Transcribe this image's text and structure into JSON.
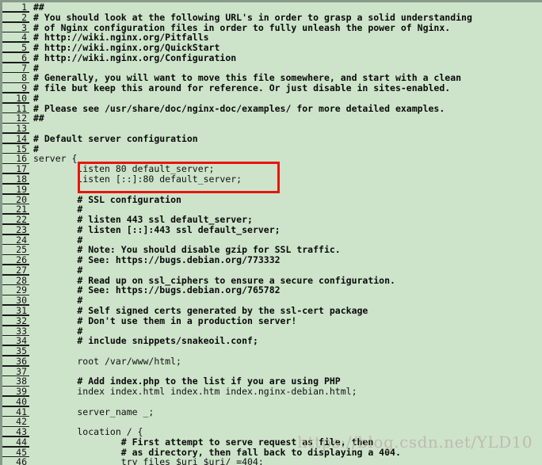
{
  "editor": {
    "background_color": "#cde4ca",
    "text_color": "#0b0b0b",
    "gutter_rule_color": "#1a1a1a",
    "border_color": "#8a9a8a",
    "file_kind": "nginx default site configuration"
  },
  "annotation": {
    "highlight_color": "#e8150f",
    "label": "listen directives highlighted"
  },
  "watermark": {
    "text": "https://blog.csdn.net/YLD10",
    "color": "#b8aaa2"
  },
  "lines": [
    {
      "n": "1",
      "text": "##",
      "style": "comment"
    },
    {
      "n": "2",
      "text": "# You should look at the following URL's in order to grasp a solid understanding",
      "style": "comment"
    },
    {
      "n": "3",
      "text": "# of Nginx configuration files in order to fully unleash the power of Nginx.",
      "style": "comment"
    },
    {
      "n": "4",
      "text": "# http://wiki.nginx.org/Pitfalls",
      "style": "comment"
    },
    {
      "n": "5",
      "text": "# http://wiki.nginx.org/QuickStart",
      "style": "comment"
    },
    {
      "n": "6",
      "text": "# http://wiki.nginx.org/Configuration",
      "style": "comment"
    },
    {
      "n": "7",
      "text": "#",
      "style": "comment"
    },
    {
      "n": "8",
      "text": "# Generally, you will want to move this file somewhere, and start with a clean",
      "style": "comment"
    },
    {
      "n": "9",
      "text": "# file but keep this around for reference. Or just disable in sites-enabled.",
      "style": "comment"
    },
    {
      "n": "10",
      "text": "#",
      "style": "comment"
    },
    {
      "n": "11",
      "text": "# Please see /usr/share/doc/nginx-doc/examples/ for more detailed examples.",
      "style": "comment"
    },
    {
      "n": "12",
      "text": "##",
      "style": "comment"
    },
    {
      "n": "13",
      "text": "",
      "style": "code"
    },
    {
      "n": "14",
      "text": "# Default server configuration",
      "style": "comment"
    },
    {
      "n": "15",
      "text": "#",
      "style": "comment"
    },
    {
      "n": "16",
      "text": "server {",
      "style": "code"
    },
    {
      "n": "17",
      "text": "        listen 80 default_server;",
      "style": "code"
    },
    {
      "n": "18",
      "text": "        listen [::]:80 default_server;",
      "style": "code"
    },
    {
      "n": "19",
      "text": "",
      "style": "code"
    },
    {
      "n": "20",
      "text": "        # SSL configuration",
      "style": "comment"
    },
    {
      "n": "21",
      "text": "        #",
      "style": "comment"
    },
    {
      "n": "22",
      "text": "        # listen 443 ssl default_server;",
      "style": "comment"
    },
    {
      "n": "23",
      "text": "        # listen [::]:443 ssl default_server;",
      "style": "comment"
    },
    {
      "n": "24",
      "text": "        #",
      "style": "comment"
    },
    {
      "n": "25",
      "text": "        # Note: You should disable gzip for SSL traffic.",
      "style": "comment"
    },
    {
      "n": "26",
      "text": "        # See: https://bugs.debian.org/773332",
      "style": "comment"
    },
    {
      "n": "27",
      "text": "        #",
      "style": "comment"
    },
    {
      "n": "28",
      "text": "        # Read up on ssl_ciphers to ensure a secure configuration.",
      "style": "comment"
    },
    {
      "n": "29",
      "text": "        # See: https://bugs.debian.org/765782",
      "style": "comment"
    },
    {
      "n": "30",
      "text": "        #",
      "style": "comment"
    },
    {
      "n": "31",
      "text": "        # Self signed certs generated by the ssl-cert package",
      "style": "comment"
    },
    {
      "n": "32",
      "text": "        # Don't use them in a production server!",
      "style": "comment"
    },
    {
      "n": "33",
      "text": "        #",
      "style": "comment"
    },
    {
      "n": "34",
      "text": "        # include snippets/snakeoil.conf;",
      "style": "comment"
    },
    {
      "n": "35",
      "text": "",
      "style": "code"
    },
    {
      "n": "36",
      "text": "        root /var/www/html;",
      "style": "code"
    },
    {
      "n": "37",
      "text": "",
      "style": "code"
    },
    {
      "n": "38",
      "text": "        # Add index.php to the list if you are using PHP",
      "style": "comment"
    },
    {
      "n": "39",
      "text": "        index index.html index.htm index.nginx-debian.html;",
      "style": "code"
    },
    {
      "n": "40",
      "text": "",
      "style": "code"
    },
    {
      "n": "41",
      "text": "        server_name _;",
      "style": "code"
    },
    {
      "n": "42",
      "text": "",
      "style": "code"
    },
    {
      "n": "43",
      "text": "        location / {",
      "style": "code"
    },
    {
      "n": "44",
      "text": "                # First attempt to serve request as file, then",
      "style": "comment"
    },
    {
      "n": "45",
      "text": "                # as directory, then fall back to displaying a 404.",
      "style": "comment"
    },
    {
      "n": "46",
      "text": "                try_files $uri $uri/ =404;",
      "style": "code"
    }
  ]
}
